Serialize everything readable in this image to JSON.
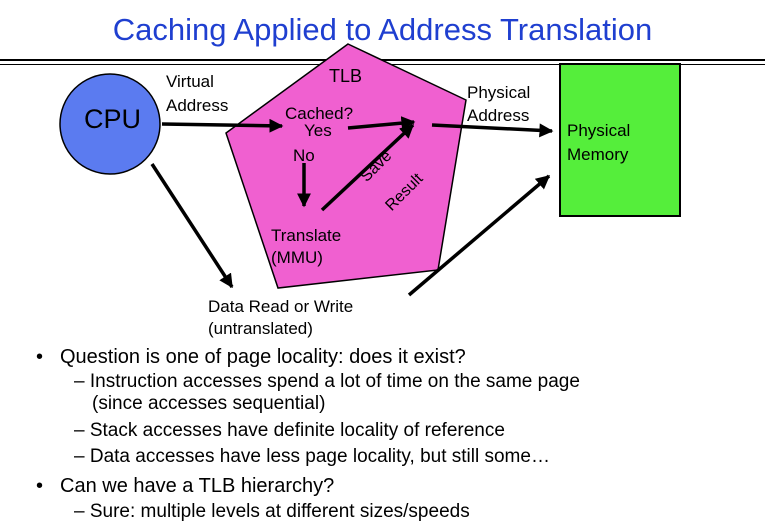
{
  "slide": {
    "title": "Caching Applied to Address Translation"
  },
  "diagram": {
    "cpu": "CPU",
    "virtual_address": [
      "Virtual",
      "Address"
    ],
    "tlb": "TLB",
    "cached": "Cached?",
    "yes": "Yes",
    "no": "No",
    "translate": [
      "Translate",
      "(MMU)"
    ],
    "save_result": [
      "Save",
      "Result"
    ],
    "physical_address": [
      "Physical",
      "Address"
    ],
    "physical_memory": [
      "Physical",
      "Memory"
    ],
    "data_rw": [
      "Data Read or Write",
      "(untranslated)"
    ],
    "colors": {
      "cpu": "#5b7bf0",
      "tlb": "#f060d0",
      "memory": "#55ee3b",
      "title": "#1f3fd0"
    }
  },
  "bullets": [
    {
      "text": "Question is one of page locality: does it exist?",
      "subs": [
        "Instruction accesses spend a lot of time on the same page",
        "(since accesses sequential)",
        "Stack accesses have definite locality of reference",
        "Data accesses have less page locality, but still some…"
      ]
    },
    {
      "text": "Can we have a TLB hierarchy?",
      "subs": [
        "Sure: multiple levels at different sizes/speeds"
      ]
    }
  ]
}
